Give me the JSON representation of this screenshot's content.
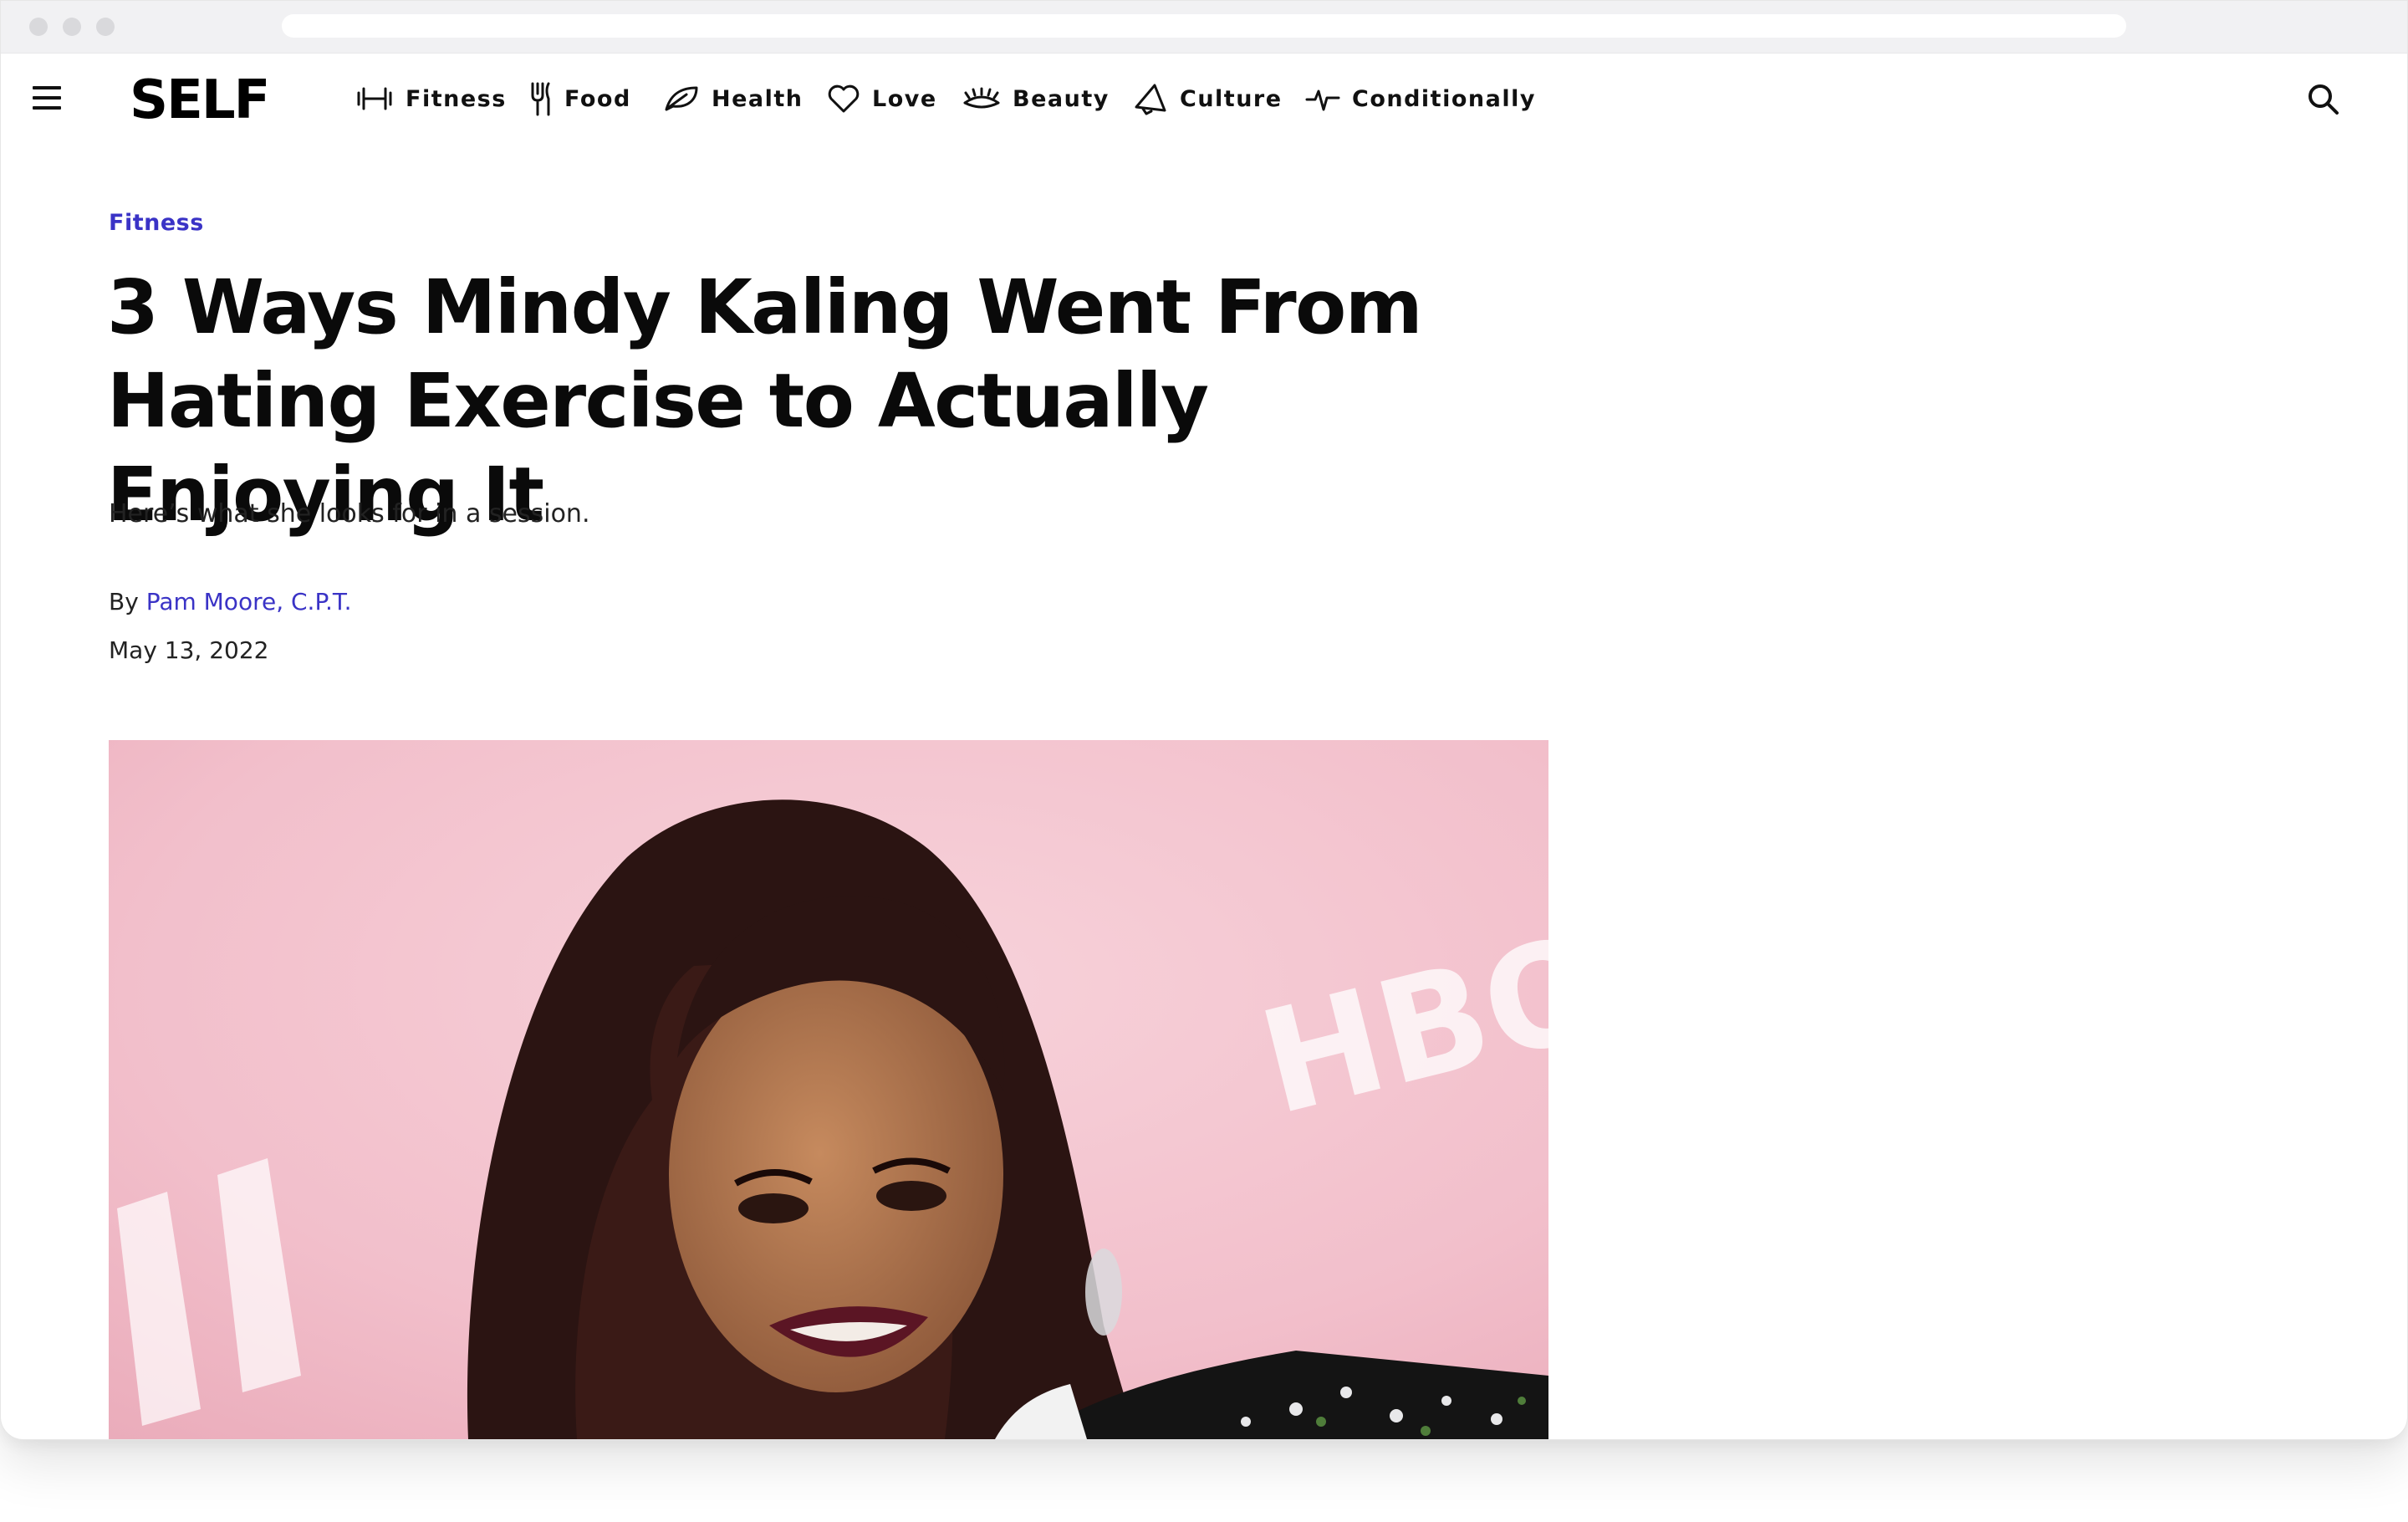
{
  "nav": {
    "logo": "SELF",
    "items": [
      {
        "label": "Fitness",
        "icon": "dumbbell-icon"
      },
      {
        "label": "Food",
        "icon": "fork-icon"
      },
      {
        "label": "Health",
        "icon": "leaf-icon"
      },
      {
        "label": "Love",
        "icon": "heart-icon"
      },
      {
        "label": "Beauty",
        "icon": "eyelash-icon"
      },
      {
        "label": "Culture",
        "icon": "megaphone-icon"
      },
      {
        "label": "Conditionally",
        "icon": "heartbeat-icon"
      }
    ]
  },
  "article": {
    "category": "Fitness",
    "headline": "3 Ways Mindy Kaling Went From Hating Exercise to Actually Enjoying It",
    "dek": "Here’s what she looks for in a session.",
    "byline_prefix": "By",
    "author": "Pam Moore, C.P.T.",
    "date": "May 13, 2022",
    "hero_backdrop_text": "HBO"
  },
  "colors": {
    "accent": "#3a33c6",
    "text": "#0a0a0a",
    "hero_background": "#f4c3cd"
  }
}
